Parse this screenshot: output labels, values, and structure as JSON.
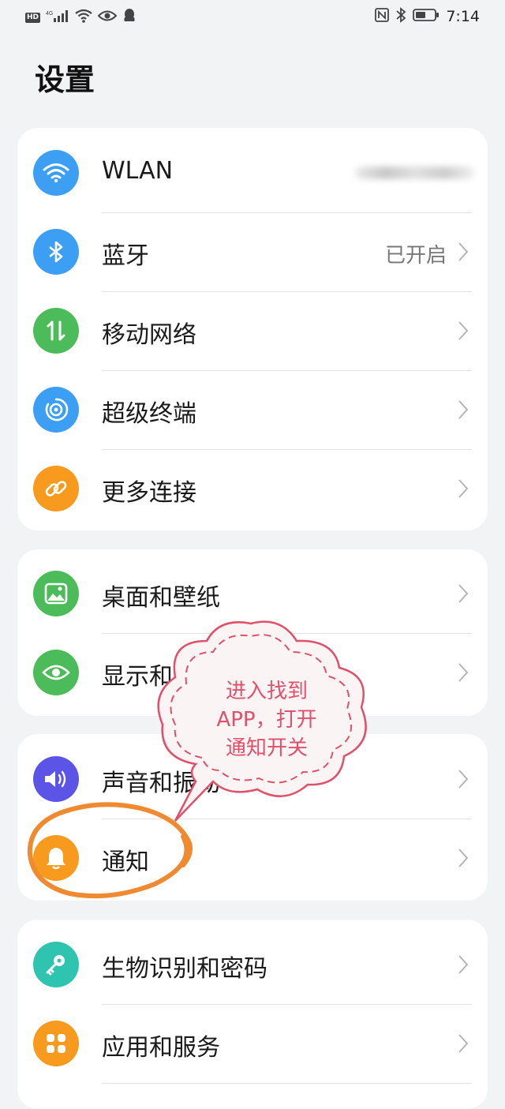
{
  "status_bar": {
    "badge": "HD",
    "network": "4G",
    "time": "7:14"
  },
  "page_title": "设置",
  "groups": [
    {
      "items": [
        {
          "label": "WLAN",
          "icon": "wifi-icon",
          "color": "#3d9ff3",
          "value": ""
        },
        {
          "label": "蓝牙",
          "icon": "bluetooth-icon",
          "color": "#3d9ff3",
          "value": "已开启"
        },
        {
          "label": "移动网络",
          "icon": "mobile-data-icon",
          "color": "#4cbc5a",
          "value": ""
        },
        {
          "label": "超级终端",
          "icon": "super-device-icon",
          "color": "#3d9ff3",
          "value": ""
        },
        {
          "label": "更多连接",
          "icon": "link-icon",
          "color": "#f79a1d",
          "value": ""
        }
      ]
    },
    {
      "items": [
        {
          "label": "桌面和壁纸",
          "icon": "wallpaper-icon",
          "color": "#4cbc5a",
          "value": ""
        },
        {
          "label": "显示和亮度",
          "icon": "eye-icon",
          "color": "#4cbc5a",
          "value": ""
        }
      ]
    },
    {
      "items": [
        {
          "label": "声音和振动",
          "icon": "speaker-icon",
          "color": "#5b54e6",
          "value": ""
        },
        {
          "label": "通知",
          "icon": "bell-icon",
          "color": "#f79a1d",
          "value": ""
        }
      ]
    },
    {
      "items": [
        {
          "label": "生物识别和密码",
          "icon": "key-icon",
          "color": "#2ec4b0",
          "value": ""
        },
        {
          "label": "应用和服务",
          "icon": "apps-icon",
          "color": "#f79a1d",
          "value": ""
        }
      ]
    }
  ],
  "annotation": {
    "line1": "进入找到",
    "line2": "APP，打开",
    "line3": "通知开关",
    "bubble_color": "#e0506a",
    "circle_color": "#f08a30"
  }
}
